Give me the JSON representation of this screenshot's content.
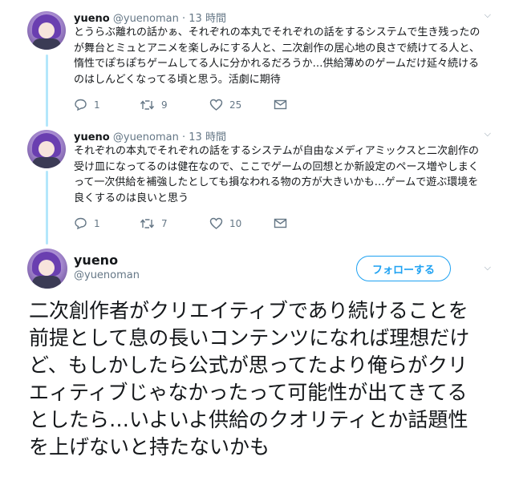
{
  "tweets": [
    {
      "name": "yueno",
      "handle": "@yuenoman",
      "time": "· 13 時間",
      "text": "とうらぶ離れの話かぁ、それぞれの本丸でそれぞれの話をするシステムで生き残ったのが舞台とミュとアニメを楽しみにする人と、二次創作の居心地の良さで続けてる人と、惰性でぽちぽちゲームしてる人に分かれるだろうか…供給薄めのゲームだけ延々続けるのはしんどくなってる頃と思う。活劇に期待",
      "replies": "1",
      "retweets": "9",
      "likes": "25"
    },
    {
      "name": "yueno",
      "handle": "@yuenoman",
      "time": "· 13 時間",
      "text": "それぞれの本丸でそれぞれの話をするシステムが自由なメディアミックスと二次創作の受け皿になってるのは健在なので、ここでゲームの回想とか新設定のペース増やしまくって一次供給を補強したとしても損なわれる物の方が大きいかも…ゲームで遊ぶ環境を良くするのは良いと思う",
      "replies": "1",
      "retweets": "7",
      "likes": "10"
    }
  ],
  "main_tweet": {
    "name": "yueno",
    "handle": "@yuenoman",
    "follow_label": "フォローする",
    "text": "二次創作者がクリエイティブであり続けることを前提として息の長いコンテンツになれば理想だけど、もしかしたら公式が思ってたより俺らがクリエィティブじゃなかったって可能性が出てきてるとしたら…いよいよ供給のクオリティとか話題性を上げないと持たないかも"
  },
  "icons": [
    "avatar",
    "chevron-down-icon",
    "reply-icon",
    "retweet-icon",
    "like-icon",
    "dm-icon"
  ],
  "colors": {
    "accent": "#1da1f2",
    "muted": "#657786",
    "thread_line": "#b4e7fb"
  }
}
